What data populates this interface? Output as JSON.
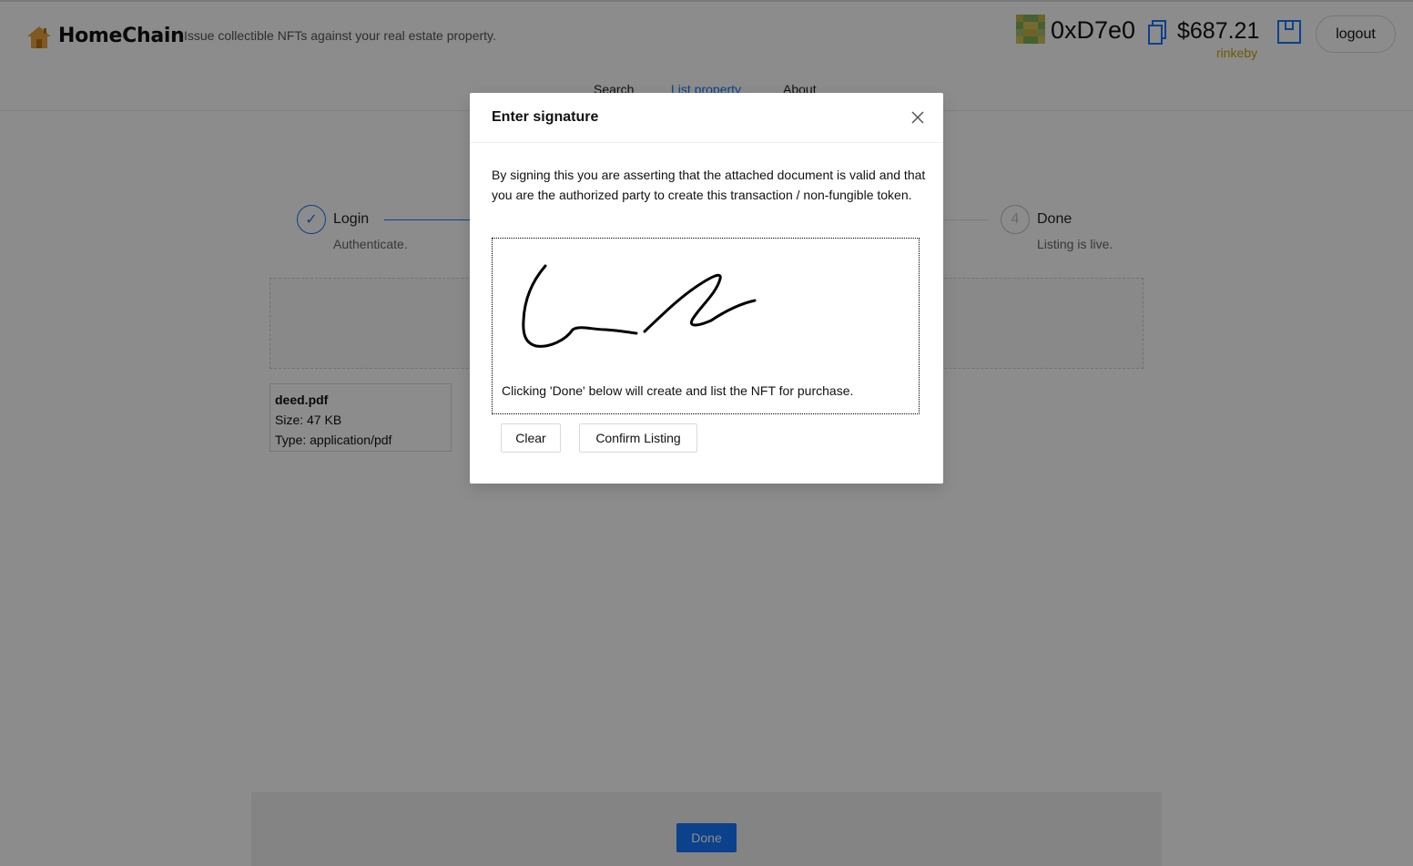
{
  "app": {
    "brand": "HomeChain",
    "tagline": "Issue collectible NFTs against your real estate property."
  },
  "nav": {
    "items": [
      {
        "label": "Search"
      },
      {
        "label": "List property"
      },
      {
        "label": "About"
      }
    ],
    "active": "List property"
  },
  "account": {
    "address": "0xD7e0",
    "balance": "$687.21",
    "network": "rinkeby",
    "logout_label": "logout"
  },
  "steps": [
    {
      "title": "Login",
      "description": "Authenticate.",
      "status": "done"
    },
    {
      "number": "4",
      "title": "Done",
      "description": "Listing is live.",
      "status": "wait"
    }
  ],
  "file": {
    "name": "deed.pdf",
    "size": "Size: 47 KB",
    "type": "Type: application/pdf"
  },
  "footer": {
    "done_label": "Done"
  },
  "modal": {
    "title": "Enter signature",
    "body": "By signing this you are asserting that the attached document is valid and that you are the authorized party to create this transaction / non-fungible token.",
    "note": "Clicking 'Done' below will create and list the NFT for purchase.",
    "clear_label": "Clear",
    "confirm_label": "Confirm Listing"
  },
  "colors": {
    "primary": "#1677ff",
    "network": "#c8a400",
    "overlay": "rgba(0,0,0,0.45)"
  }
}
